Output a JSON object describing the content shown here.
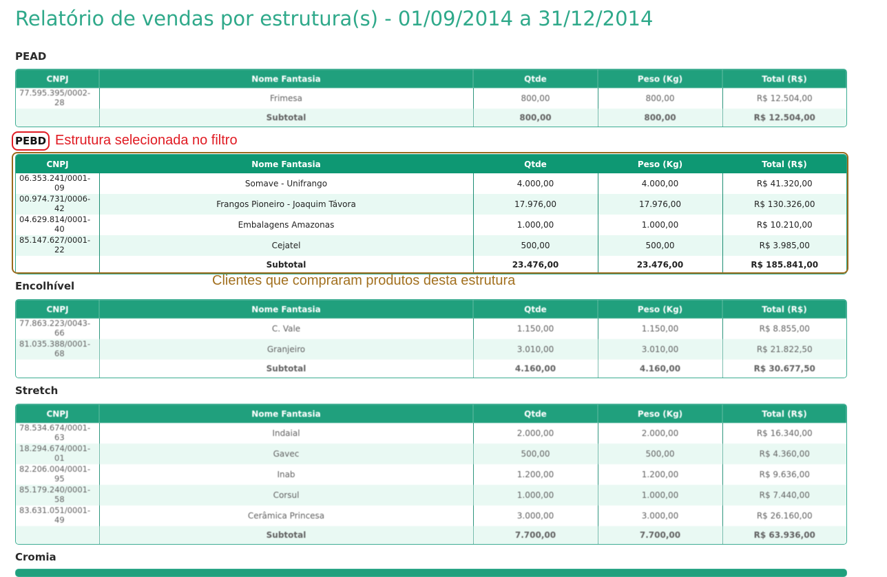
{
  "title": "Relatório de vendas por estrutura(s) - 01/09/2014 a 31/12/2014",
  "columns": [
    "CNPJ",
    "Nome Fantasia",
    "Qtde",
    "Peso (Kg)",
    "Total (R$)"
  ],
  "subtotal_label": "Subtotal",
  "annotations": {
    "selected_filter": "Estrutura selecionada no filtro",
    "clients_note": "Clientes que compraram produtos desta estrutura"
  },
  "sections": [
    {
      "name": "PEAD",
      "rows": [
        {
          "cnpj_1": "77.595.395/0002-",
          "cnpj_2": "28",
          "nome": "Frimesa",
          "qtde": "800,00",
          "peso": "800,00",
          "total": "R$ 12.504,00"
        }
      ],
      "subtotal": {
        "qtde": "800,00",
        "peso": "800,00",
        "total": "R$ 12.504,00"
      }
    },
    {
      "name": "PEBD",
      "rows": [
        {
          "cnpj_1": "06.353.241/0001-",
          "cnpj_2": "09",
          "nome": "Somave - Unifrango",
          "qtde": "4.000,00",
          "peso": "4.000,00",
          "total": "R$ 41.320,00"
        },
        {
          "cnpj_1": "00.974.731/0006-",
          "cnpj_2": "42",
          "nome": "Frangos Pioneiro - Joaquim Távora",
          "qtde": "17.976,00",
          "peso": "17.976,00",
          "total": "R$ 130.326,00"
        },
        {
          "cnpj_1": "04.629.814/0001-",
          "cnpj_2": "40",
          "nome": "Embalagens Amazonas",
          "qtde": "1.000,00",
          "peso": "1.000,00",
          "total": "R$ 10.210,00"
        },
        {
          "cnpj_1": "85.147.627/0001-",
          "cnpj_2": "22",
          "nome": "Cejatel",
          "qtde": "500,00",
          "peso": "500,00",
          "total": "R$ 3.985,00"
        }
      ],
      "subtotal": {
        "qtde": "23.476,00",
        "peso": "23.476,00",
        "total": "R$ 185.841,00"
      }
    },
    {
      "name": "Encolhível",
      "rows": [
        {
          "cnpj_1": "77.863.223/0043-",
          "cnpj_2": "66",
          "nome": "C. Vale",
          "qtde": "1.150,00",
          "peso": "1.150,00",
          "total": "R$ 8.855,00"
        },
        {
          "cnpj_1": "81.035.388/0001-",
          "cnpj_2": "68",
          "nome": "Granjeiro",
          "qtde": "3.010,00",
          "peso": "3.010,00",
          "total": "R$ 21.822,50"
        }
      ],
      "subtotal": {
        "qtde": "4.160,00",
        "peso": "4.160,00",
        "total": "R$ 30.677,50"
      }
    },
    {
      "name": "Stretch",
      "rows": [
        {
          "cnpj_1": "78.534.674/0001-",
          "cnpj_2": "63",
          "nome": "Indaial",
          "qtde": "2.000,00",
          "peso": "2.000,00",
          "total": "R$ 16.340,00"
        },
        {
          "cnpj_1": "18.294.674/0001-",
          "cnpj_2": "01",
          "nome": "Gavec",
          "qtde": "500,00",
          "peso": "500,00",
          "total": "R$ 4.360,00"
        },
        {
          "cnpj_1": "82.206.004/0001-",
          "cnpj_2": "95",
          "nome": "Inab",
          "qtde": "1.200,00",
          "peso": "1.200,00",
          "total": "R$ 9.636,00"
        },
        {
          "cnpj_1": "85.179.240/0001-",
          "cnpj_2": "58",
          "nome": "Corsul",
          "qtde": "1.000,00",
          "peso": "1.000,00",
          "total": "R$ 7.440,00"
        },
        {
          "cnpj_1": "83.631.051/0001-",
          "cnpj_2": "49",
          "nome": "Cerâmica Princesa",
          "qtde": "3.000,00",
          "peso": "3.000,00",
          "total": "R$ 26.160,00"
        }
      ],
      "subtotal": {
        "qtde": "7.700,00",
        "peso": "7.700,00",
        "total": "R$ 63.936,00"
      }
    },
    {
      "name": "Cromia",
      "rows": [],
      "subtotal": null
    }
  ]
}
